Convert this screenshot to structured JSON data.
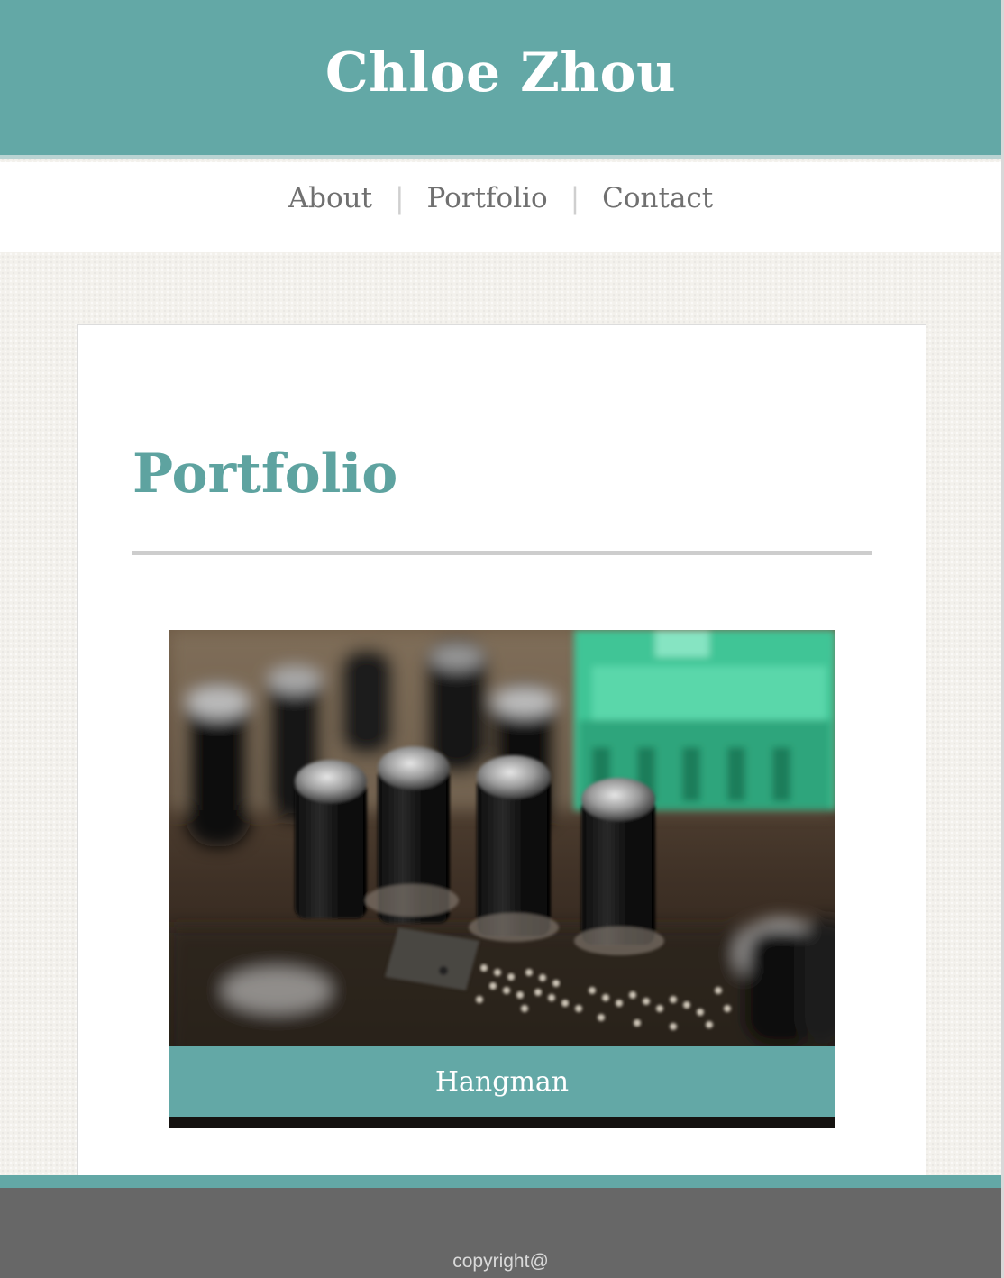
{
  "header": {
    "title": "Chloe Zhou"
  },
  "nav": {
    "items": [
      {
        "label": "About"
      },
      {
        "label": "Portfolio"
      },
      {
        "label": "Contact"
      }
    ],
    "separator": "|"
  },
  "main": {
    "heading": "Portfolio",
    "items": [
      {
        "caption": "Hangman",
        "image": "circuit-board-capacitors-photo"
      }
    ]
  },
  "footer": {
    "copyright": "copyright@"
  },
  "colors": {
    "accent": "#63a8a6",
    "heading": "#5ea3a0",
    "footer": "#676767",
    "nav_text": "#707070"
  }
}
